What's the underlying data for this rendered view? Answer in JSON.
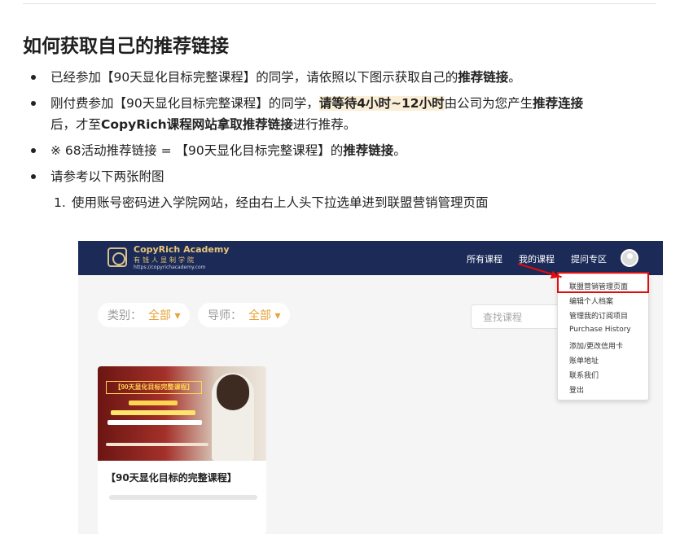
{
  "article": {
    "title": "如何获取自己的推荐链接",
    "bullet1": {
      "pre": "已经参加【90天显化目标完整课程】的同学，请依照以下图示获取自己的",
      "bold": "推荐链接",
      "post": "。"
    },
    "bullet2": {
      "pre": "刚付费参加【90天显化目标完整课程】的同学，",
      "hl": "请等待4小时~12小时",
      "mid": "由公司为您产生",
      "bold1": "推荐连接",
      "mid2": "后，才至",
      "bold2": "CopyRich课程网站拿取推荐链接",
      "post": "进行推荐。"
    },
    "bullet3": {
      "pre": "※ 68活动推荐链接 = 【90天显化目标完整课程】的",
      "bold": "推荐链接",
      "post": "。"
    },
    "bullet4": "请参考以下两张附图",
    "step1": {
      "num": "1.",
      "text": "使用账号密码进入学院网站，经由右上人头下拉选单进到联盟营销管理页面"
    }
  },
  "screenshot": {
    "brand": {
      "name": "CopyRich Academy",
      "subtitle": "有钱人显制学院",
      "url": "https://copyrichacademy.com"
    },
    "nav": [
      "所有课程",
      "我的课程",
      "提问专区"
    ],
    "filters": [
      {
        "key": "类别：",
        "value": "全部 ▾"
      },
      {
        "key": "导师：",
        "value": "全部 ▾"
      }
    ],
    "search_placeholder": "查找课程",
    "course": {
      "title": "【90天显化目标的完整课程】",
      "thumb_banner": "【90天显化目标完整课程】",
      "progress": 0
    },
    "menu": [
      "联盟营销管理页面",
      "编辑个人档案",
      "管理我的订阅项目",
      "Purchase History",
      "添加/更改信用卡",
      "账单地址",
      "联系我们",
      "登出"
    ],
    "colors": {
      "nav_bg": "#1b2a57",
      "accent": "#e7a43a",
      "highlight": "#e10c0c"
    }
  }
}
